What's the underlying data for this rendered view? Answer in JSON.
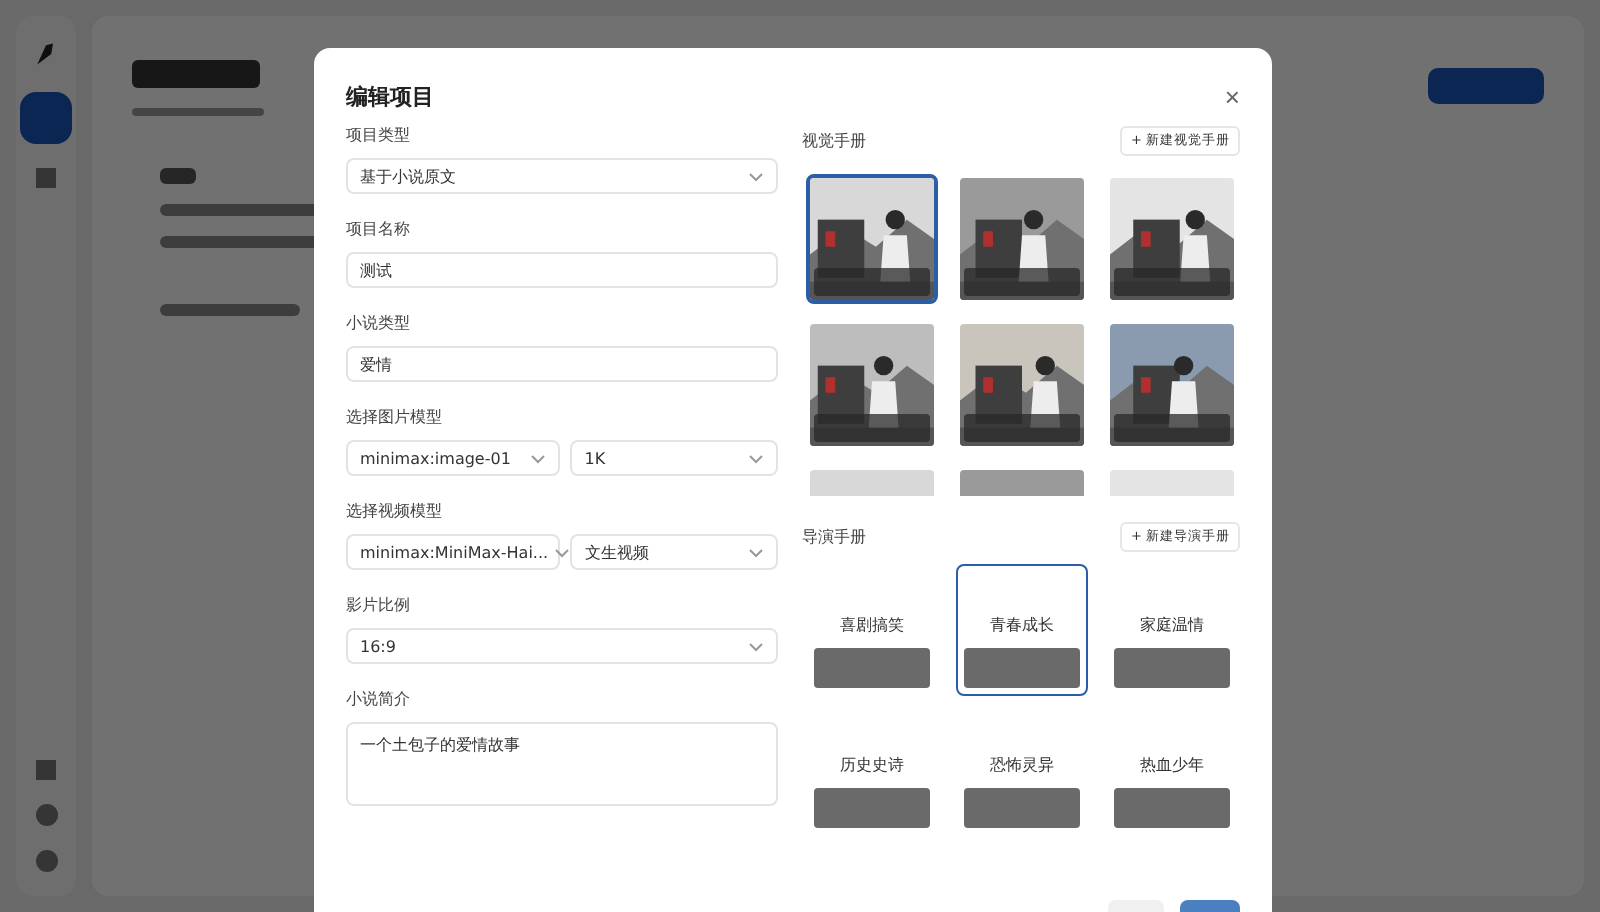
{
  "dialog": {
    "title": "编辑项目",
    "close": "×"
  },
  "fields": [
    {
      "kind": "select",
      "label": "项目类型",
      "value": "基于小说原文"
    },
    {
      "kind": "input",
      "label": "项目名称",
      "value": "测试"
    },
    {
      "kind": "input",
      "label": "小说类型",
      "value": "爱情"
    },
    {
      "kind": "select_pair",
      "label": "选择图片模型",
      "values": [
        "minimax:image-01",
        "1K"
      ]
    },
    {
      "kind": "select_pair",
      "label": "选择视频模型",
      "values": [
        "minimax:MiniMax-Hai...",
        "文生视频"
      ]
    },
    {
      "kind": "select",
      "label": "影片比例",
      "value": "16:9"
    },
    {
      "kind": "textarea",
      "label": "小说简介",
      "value": "一个土包子的爱情故事"
    }
  ],
  "visual_manual": {
    "title": "视觉手册",
    "add_button": "+ 新建视觉手册",
    "cards": [
      {
        "selected": true
      },
      {
        "selected": false
      },
      {
        "selected": false
      },
      {
        "selected": false
      },
      {
        "selected": false
      },
      {
        "selected": false
      },
      {
        "selected": false
      },
      {
        "selected": false
      },
      {
        "selected": false
      }
    ]
  },
  "director_manual": {
    "title": "导演手册",
    "add_button": "+ 新建导演手册",
    "cards": [
      {
        "name": "喜剧搞笑",
        "selected": false
      },
      {
        "name": "青春成长",
        "selected": true
      },
      {
        "name": "家庭温情",
        "selected": false
      },
      {
        "name": "历史史诗",
        "selected": false
      },
      {
        "name": "恐怖灵异",
        "selected": false
      },
      {
        "name": "热血少年",
        "selected": false
      }
    ]
  }
}
